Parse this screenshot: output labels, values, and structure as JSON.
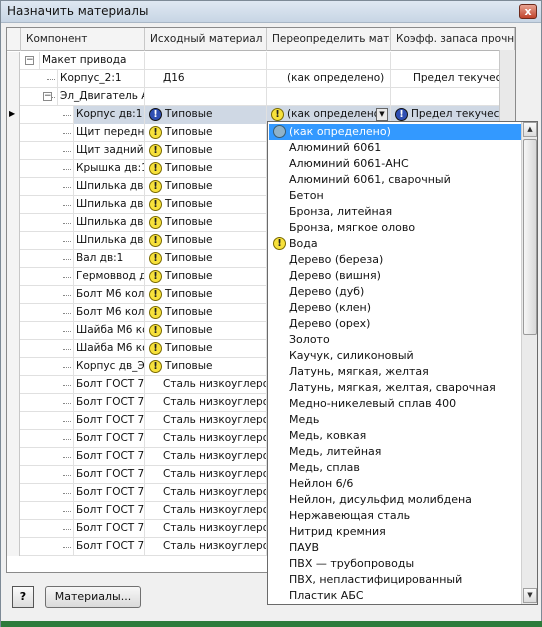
{
  "window": {
    "title": "Назначить материалы",
    "close_label": "x"
  },
  "columns": [
    {
      "label": "Компонент"
    },
    {
      "label": "Исходный материал"
    },
    {
      "label": "Переопределить матер"
    },
    {
      "label": "Коэфф. запаса прочно"
    }
  ],
  "rows": [
    {
      "name": "Макет привода",
      "orig": "",
      "override": "",
      "coef": ""
    },
    {
      "name": "Корпус_2:1",
      "orig": "Д16",
      "override": "(как определено)",
      "coef": "Предел текучести"
    },
    {
      "name": "Эл_Двигатель А",
      "orig": "",
      "override": "",
      "coef": ""
    },
    {
      "name": "Корпус дв:1",
      "orig": "Типовые",
      "override": "(как определено",
      "coef": "Предел текучести"
    },
    {
      "name": "Щит передни",
      "orig": "Типовые"
    },
    {
      "name": "Щит задний:",
      "orig": "Типовые"
    },
    {
      "name": "Крышка дв:1",
      "orig": "Типовые"
    },
    {
      "name": "Шпилька дв:",
      "orig": "Типовые"
    },
    {
      "name": "Шпилька дв:",
      "orig": "Типовые"
    },
    {
      "name": "Шпилька дв:",
      "orig": "Типовые"
    },
    {
      "name": "Шпилька дв:",
      "orig": "Типовые"
    },
    {
      "name": "Вал дв:1",
      "orig": "Типовые"
    },
    {
      "name": "Гермоввод дв",
      "orig": "Типовые"
    },
    {
      "name": "Болт М6 коле",
      "orig": "Типовые"
    },
    {
      "name": "Болт М6 коле",
      "orig": "Типовые"
    },
    {
      "name": "Шайба М6 ко",
      "orig": "Типовые"
    },
    {
      "name": "Шайба М6 ко",
      "orig": "Типовые"
    },
    {
      "name": "Корпус дв_Э",
      "orig": "Типовые"
    },
    {
      "name": "Болт ГОСТ 78",
      "orig": "Сталь низкоуглерод"
    },
    {
      "name": "Болт ГОСТ 78",
      "orig": "Сталь низкоуглерод"
    },
    {
      "name": "Болт ГОСТ 78",
      "orig": "Сталь низкоуглерод"
    },
    {
      "name": "Болт ГОСТ 78",
      "orig": "Сталь низкоуглерод"
    },
    {
      "name": "Болт ГОСТ 78",
      "orig": "Сталь низкоуглерод"
    },
    {
      "name": "Болт ГОСТ 78",
      "orig": "Сталь низкоуглерод"
    },
    {
      "name": "Болт ГОСТ 78",
      "orig": "Сталь низкоуглерод"
    },
    {
      "name": "Болт ГОСТ 78",
      "orig": "Сталь низкоуглерод"
    },
    {
      "name": "Болт ГОСТ 78",
      "orig": "Сталь низкоуглерод"
    },
    {
      "name": "Болт ГОСТ 78",
      "orig": "Сталь низкоуглерод"
    }
  ],
  "dropdown": {
    "items": [
      {
        "label": "(как определено)",
        "icon": "globe-icon",
        "selected": true
      },
      {
        "label": "Алюминий 6061"
      },
      {
        "label": "Алюминий 6061-АНС"
      },
      {
        "label": "Алюминий 6061, сварочный"
      },
      {
        "label": "Бетон"
      },
      {
        "label": "Бронза, литейная"
      },
      {
        "label": "Бронза, мягкое олово"
      },
      {
        "label": "Вода",
        "icon": "warning-icon"
      },
      {
        "label": "Дерево (береза)"
      },
      {
        "label": "Дерево (вишня)"
      },
      {
        "label": "Дерево (дуб)"
      },
      {
        "label": "Дерево (клен)"
      },
      {
        "label": "Дерево (орех)"
      },
      {
        "label": "Золото"
      },
      {
        "label": "Каучук, силиконовый"
      },
      {
        "label": "Латунь, мягкая, желтая"
      },
      {
        "label": "Латунь, мягкая, желтая, сварочная"
      },
      {
        "label": "Медно-никелевый сплав 400"
      },
      {
        "label": "Медь"
      },
      {
        "label": "Медь, ковкая"
      },
      {
        "label": "Медь, литейная"
      },
      {
        "label": "Медь, сплав"
      },
      {
        "label": "Нейлон 6/6"
      },
      {
        "label": "Нейлон, дисульфид молибдена"
      },
      {
        "label": "Нержавеющая сталь"
      },
      {
        "label": "Нитрид кремния"
      },
      {
        "label": "ПАУВ"
      },
      {
        "label": "ПВХ — трубопроводы"
      },
      {
        "label": "ПВХ, непластифицированный"
      },
      {
        "label": "Пластик АБС"
      }
    ]
  },
  "buttons": {
    "help": "?",
    "materials": "Материалы..."
  },
  "colors": {
    "selection": "#3399ff",
    "row_highlight": "#cfd8e4"
  }
}
